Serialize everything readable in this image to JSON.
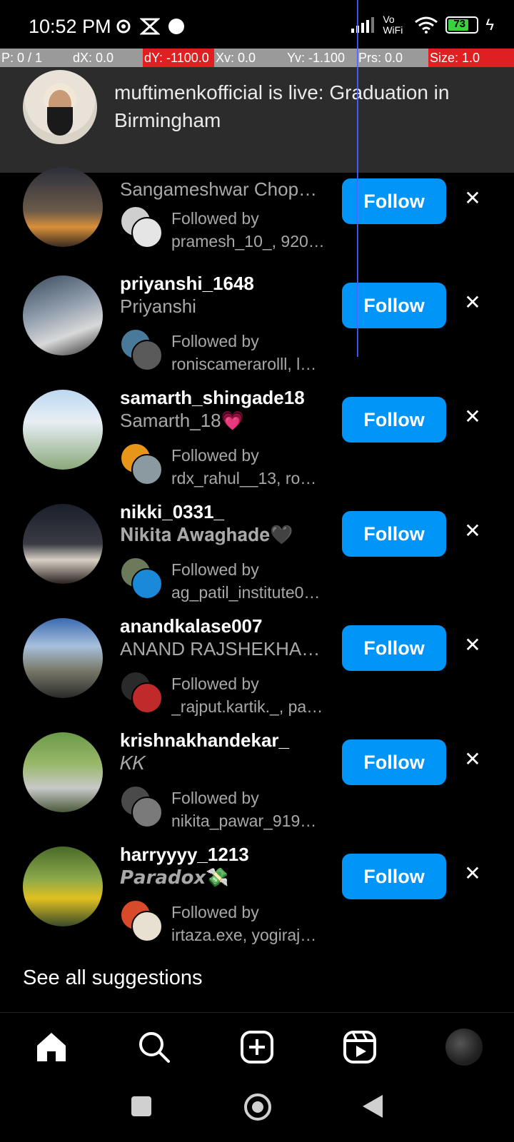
{
  "status_bar": {
    "time": "10:52 PM",
    "battery": "73",
    "network": "Vo WiFi"
  },
  "debug_bar": {
    "p": "P: 0 / 1",
    "dx": "dX: 0.0",
    "dy": "dY: -1100.0",
    "xv": "Xv: 0.0",
    "yv": "Yv: -1.100",
    "prs": "Prs: 0.0",
    "size": "Size: 1.0"
  },
  "notification": {
    "text": "muftimenkofficial is live: Graduation in Birmingham"
  },
  "suggestions": [
    {
      "username": "",
      "full_name": "Sangameshwar Chop…",
      "followed_by_label": "Followed by",
      "followed_by": "pramesh_10_, 920…",
      "follow_label": "Follow"
    },
    {
      "username": "priyanshi_1648",
      "full_name": "Priyanshi",
      "followed_by_label": "Followed by",
      "followed_by": "roniscamerarolll, l…",
      "follow_label": "Follow"
    },
    {
      "username": "samarth_shingade18",
      "full_name": "Samarth_18💗",
      "followed_by_label": "Followed by",
      "followed_by": "rdx_rahul__13, roh…",
      "follow_label": "Follow"
    },
    {
      "username": "nikki_0331_",
      "full_name": "𝐍𝐢𝐤𝐢𝐭𝐚 𝐀𝐰𝐚𝐠𝐡𝐚𝐝𝐞🖤",
      "followed_by_label": "Followed by",
      "followed_by": "ag_patil_institute0…",
      "follow_label": "Follow"
    },
    {
      "username": "anandkalase007",
      "full_name": "ANAND RAJSHEKHA…",
      "followed_by_label": "Followed by",
      "followed_by": "_rajput.kartik._, pa…",
      "follow_label": "Follow"
    },
    {
      "username": "krishnakhandekar_",
      "full_name": "𝐾𝐾",
      "followed_by_label": "Followed by",
      "followed_by": "nikita_pawar_9192…",
      "follow_label": "Follow"
    },
    {
      "username": "harryyyy_1213",
      "full_name": "𝙋𝙖𝙧𝙖𝙙𝙤𝙭💸",
      "followed_by_label": "Followed by",
      "followed_by": "irtaza.exe, yogiraj_…",
      "follow_label": "Follow"
    }
  ],
  "see_all": "See all suggestions",
  "colors": {
    "accent": "#0095f6",
    "background": "#000000"
  },
  "nav": [
    "home-icon",
    "search-icon",
    "create-icon",
    "reels-icon",
    "profile-avatar"
  ]
}
